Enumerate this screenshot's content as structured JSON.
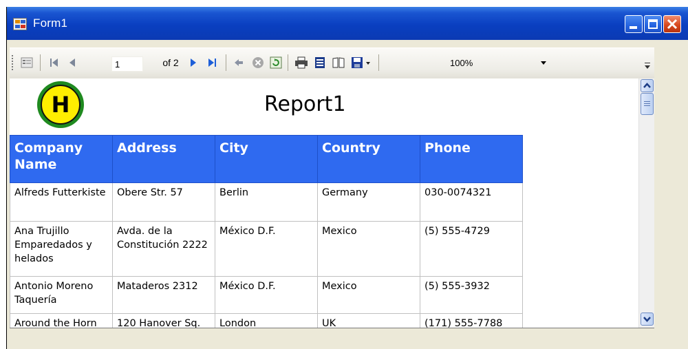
{
  "window": {
    "title": "Form1"
  },
  "toolbar": {
    "page_input_value": "1",
    "page_of_label": "of 2",
    "zoom_value": "100%"
  },
  "report": {
    "title": "Report1",
    "logo_letter": "H",
    "columns": [
      "Company Name",
      "Address",
      "City",
      "Country",
      "Phone"
    ],
    "rows": [
      [
        "Alfreds Futterkiste",
        "Obere Str. 57",
        "Berlin",
        "Germany",
        "030-0074321"
      ],
      [
        "Ana Trujillo Emparedados y helados",
        "Avda. de la Constitución 2222",
        "México D.F.",
        "Mexico",
        "(5) 555-4729"
      ],
      [
        "Antonio Moreno Taquería",
        "Mataderos 2312",
        "México D.F.",
        "Mexico",
        "(5) 555-3932"
      ],
      [
        "Around the Horn",
        "120 Hanover Sq.",
        "London",
        "UK",
        "(171) 555-7788"
      ]
    ]
  },
  "colors": {
    "header_blue": "#2f6af0",
    "titlebar_blue": "#0a3fc0"
  }
}
